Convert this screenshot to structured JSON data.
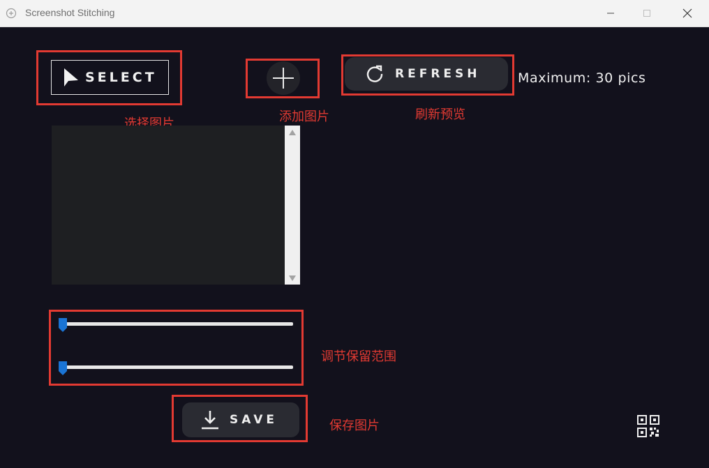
{
  "window": {
    "title": "Screenshot Stitching"
  },
  "toolbar": {
    "select_label": "SELECT",
    "refresh_label": "REFRESH",
    "maximum_text": "Maximum: 30 pics"
  },
  "annotations": {
    "select": "选择图片",
    "add": "添加图片",
    "refresh": "刷新预览",
    "sliders": "调节保留范围",
    "save": "保存图片"
  },
  "sliders": [
    {
      "value": 0
    },
    {
      "value": 0
    }
  ],
  "actions": {
    "save_label": "SAVE"
  },
  "icons": {
    "select": "cursor-arrow-icon",
    "add": "plus-icon",
    "refresh": "refresh-icon",
    "save": "download-icon",
    "qr": "qr-code-icon"
  },
  "colors": {
    "background": "#12111c",
    "annotation": "#e23a32",
    "slider_thumb": "#1a74d4",
    "button_bg": "#2a2b32"
  }
}
